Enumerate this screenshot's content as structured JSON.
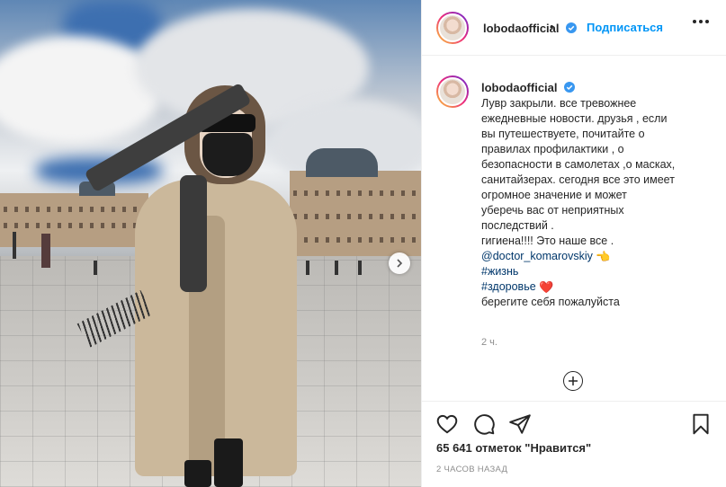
{
  "post": {
    "username": "lobodaofficial",
    "follow_separator": "•",
    "follow_label": "Подписаться",
    "caption_lines": [
      "Лувр закрыли. все тревожнее",
      "ежедневные новости. друзья , если",
      "вы путешествуете, почитайте о",
      "правилах профилактики , о",
      "безопасности в самолетах ,о масках,",
      "санитайзерах. сегодня все это имеет",
      "огромное значение и может",
      "уберечь вас от неприятных",
      "последствий .",
      "гигиена!!!! Это наше все ."
    ],
    "mention": "@doctor_komarovskiy",
    "mention_emoji": "👈",
    "hashtag_1": "#жизнь",
    "hashtag_2": "#здоровье",
    "hashtag_2_emoji": "❤️",
    "caption_last": "берегите себя пожалуйста",
    "comment_time": "2 ч.",
    "likes_text": "65 641 отметок \"Нравится\"",
    "posted_ago": "2 ЧАСОВ НАЗАД"
  },
  "colors": {
    "accent": "#0095f6",
    "link": "#00376b",
    "muted": "#8e8e8e",
    "text": "#262626",
    "heart": "#ed4956"
  },
  "icons": {
    "verified": "verified-badge-icon",
    "more": "more-options-icon",
    "next": "chevron-right-icon",
    "load_more": "plus-circle-icon",
    "like": "heart-icon",
    "comment": "comment-icon",
    "share": "paper-plane-icon",
    "save": "bookmark-icon"
  }
}
